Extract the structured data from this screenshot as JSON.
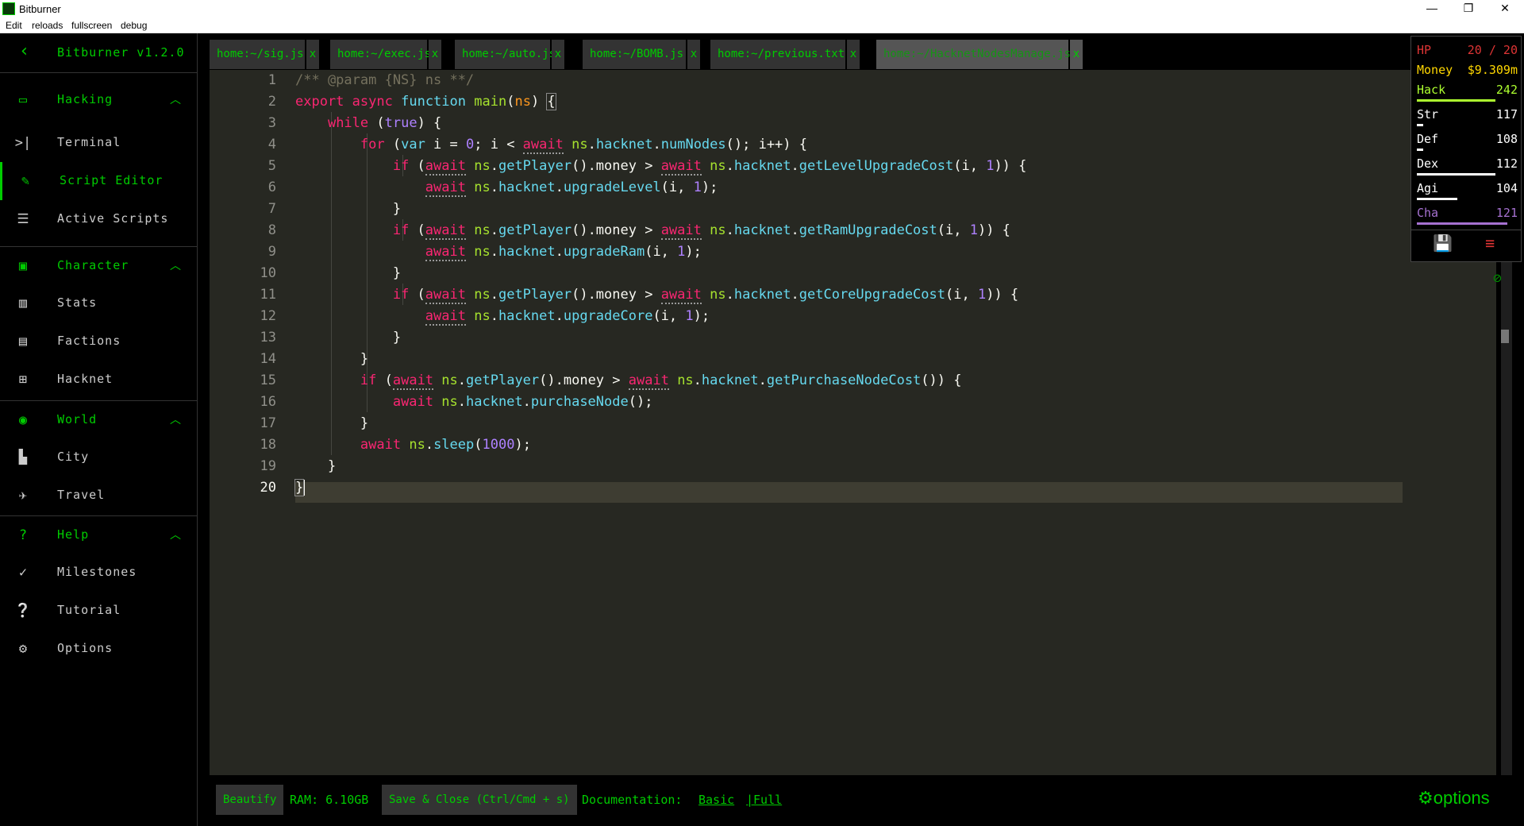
{
  "window": {
    "title": "Bitburner",
    "minimize": "—",
    "restore": "❐",
    "close": "✕"
  },
  "menu": [
    "Edit",
    "reloads",
    "fullscreen",
    "debug"
  ],
  "sidebar": {
    "back": "‹",
    "title": "Bitburner v1.2.0",
    "sections": [
      {
        "label": "Hacking",
        "icon": "laptop-icon",
        "items": [
          {
            "label": "Terminal",
            "icon": "terminal-icon"
          },
          {
            "label": "Script Editor",
            "icon": "pencil-icon",
            "active": true
          },
          {
            "label": "Active Scripts",
            "icon": "storage-icon"
          }
        ]
      },
      {
        "label": "Character",
        "icon": "account-box-icon",
        "items": [
          {
            "label": "Stats",
            "icon": "bar-chart-icon"
          },
          {
            "label": "Factions",
            "icon": "contacts-icon"
          },
          {
            "label": "Hacknet",
            "icon": "hacknet-icon"
          }
        ]
      },
      {
        "label": "World",
        "icon": "globe-icon",
        "items": [
          {
            "label": "City",
            "icon": "city-icon"
          },
          {
            "label": "Travel",
            "icon": "airplane-icon"
          }
        ]
      },
      {
        "label": "Help",
        "icon": "help-box-icon",
        "items": [
          {
            "label": "Milestones",
            "icon": "check-icon"
          },
          {
            "label": "Tutorial",
            "icon": "question-icon"
          },
          {
            "label": "Options",
            "icon": "gear-icon"
          }
        ]
      }
    ]
  },
  "tabs": [
    {
      "name": "home:~/sig.js",
      "close": "x"
    },
    {
      "name": "home:~/exec.js",
      "close": "x"
    },
    {
      "name": "home:~/auto.js",
      "close": "x"
    },
    {
      "name": "home:~/BOMB.js",
      "close": "x"
    },
    {
      "name": "home:~/previous.txt",
      "close": "x"
    },
    {
      "name": "home:~/HacknetNodesManage.js",
      "close": "x",
      "active": true
    }
  ],
  "editor": {
    "line_numbers": [
      "1",
      "2",
      "3",
      "4",
      "5",
      "6",
      "7",
      "8",
      "9",
      "10",
      "11",
      "12",
      "13",
      "14",
      "15",
      "16",
      "17",
      "18",
      "19",
      "20"
    ]
  },
  "bottom": {
    "beautify": "Beautify",
    "ram": "RAM: 6.10GB",
    "save": "Save & Close (Ctrl/Cmd + s)",
    "doc_label": "Documentation:",
    "doc_basic": "Basic",
    "doc_full": "|Full",
    "options": "options"
  },
  "stats": {
    "hp_label": "HP",
    "hp_value": "20 / 20",
    "money_label": "Money",
    "money_value": "$9.309m",
    "rows": [
      {
        "label": "Hack",
        "value": "242",
        "color": "#adff2f",
        "bar": 0.78
      },
      {
        "label": "Str",
        "value": "117",
        "color": "#ffffff",
        "bar": 0.06
      },
      {
        "label": "Def",
        "value": "108",
        "color": "#ffffff",
        "bar": 0.06
      },
      {
        "label": "Dex",
        "value": "112",
        "color": "#ffffff",
        "bar": 0.78
      },
      {
        "label": "Agi",
        "value": "104",
        "color": "#ffffff",
        "bar": 0.4
      },
      {
        "label": "Cha",
        "value": "121",
        "color": "#a671d1",
        "bar": 0.9
      }
    ],
    "colors": {
      "hp": "#dd3434",
      "money": "#ffd700"
    }
  }
}
